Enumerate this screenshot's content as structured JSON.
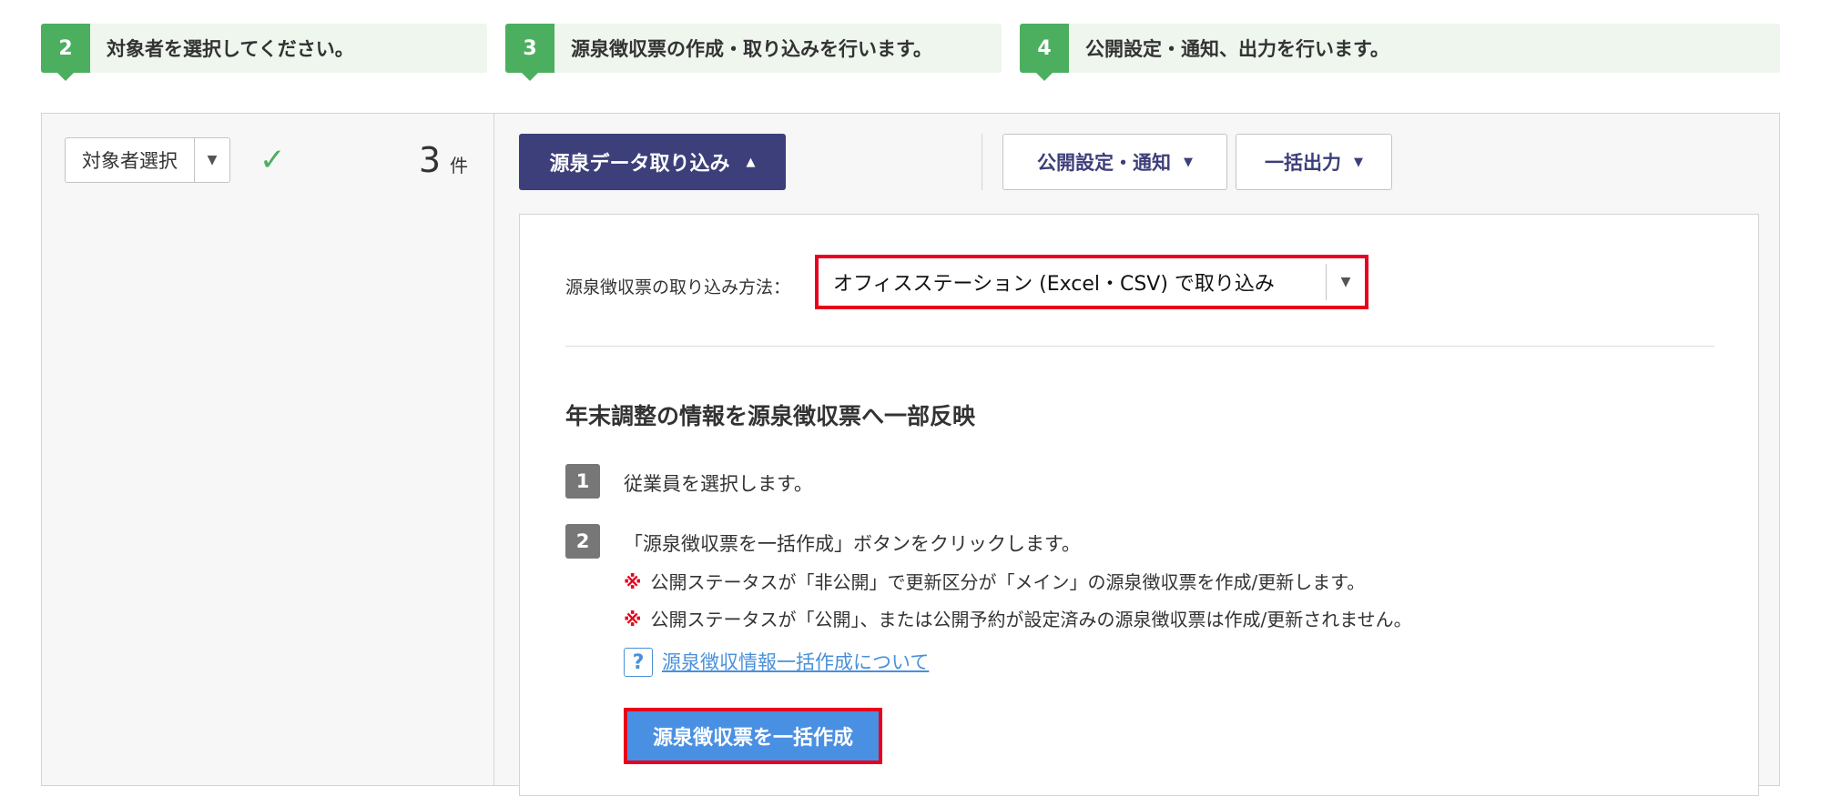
{
  "steps": [
    {
      "number": "2",
      "text": "対象者を選択してください。"
    },
    {
      "number": "3",
      "text": "源泉徴収票の作成・取り込みを行います。"
    },
    {
      "number": "4",
      "text": "公開設定・通知、出力を行います。"
    }
  ],
  "left_panel": {
    "target_select_label": "対象者選択",
    "count_value": "3",
    "count_unit": "件"
  },
  "toolbar": {
    "import_button": "源泉データ取り込み",
    "publish_button": "公開設定・通知",
    "export_button": "一括出力"
  },
  "import_panel": {
    "method_label": "源泉徴収票の取り込み方法：",
    "method_value": "オフィスステーション (Excel・CSV) で取り込み",
    "section_title": "年末調整の情報を源泉徴収票へ一部反映",
    "step1_number": "1",
    "step1_text": "従業員を選択します。",
    "step2_number": "2",
    "step2_text": "「源泉徴収票を一括作成」ボタンをクリックします。",
    "note_mark": "※",
    "note1": "公開ステータスが「非公開」で更新区分が「メイン」の源泉徴収票を作成/更新します。",
    "note2": "公開ステータスが「公開」、または公開予約が設定済みの源泉徴収票は作成/更新されません。",
    "help_icon": "?",
    "help_link": "源泉徴収情報一括作成について",
    "create_button": "源泉徴収票を一括作成"
  },
  "colors": {
    "accent_green": "#4caf5f",
    "primary_navy": "#3d3f7a",
    "highlight_red": "#e8001c",
    "link_blue": "#4a90d9",
    "button_blue": "#4a90e2"
  },
  "icons": {
    "check": "check-icon",
    "caret_down": "caret-down-icon",
    "caret_up": "caret-up-icon",
    "help": "question-icon"
  }
}
